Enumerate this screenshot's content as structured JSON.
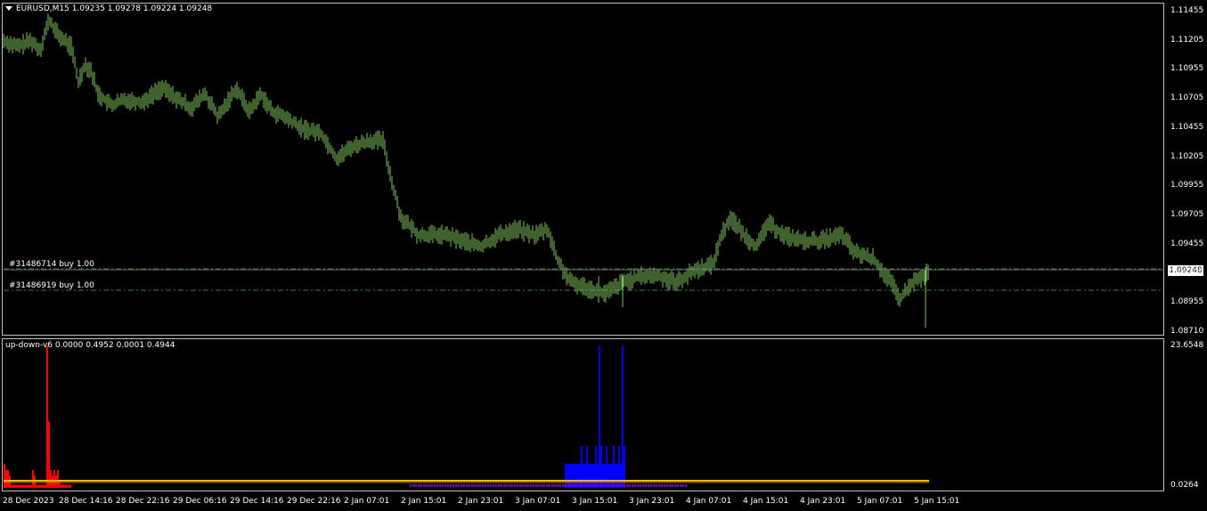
{
  "main_chart": {
    "title": "EURUSD,M15  1.09235 1.09278 1.09224 1.09248",
    "current_price_label": "1.09248",
    "price_ticks": [
      "1.11455",
      "1.11205",
      "1.10955",
      "1.10705",
      "1.10455",
      "1.10205",
      "1.09955",
      "1.09705",
      "1.09455",
      "1.09205",
      "1.08955",
      "1.08710"
    ],
    "orders": [
      {
        "label": "#31486714 buy 1.00",
        "price": 1.0926
      },
      {
        "label": "#31486919 buy 1.00",
        "price": 1.09165
      }
    ]
  },
  "indicator_panel": {
    "title": "up-down-v6 0.0000 0.4952 0.0001 0.4944",
    "top_tick": "23.6548",
    "bottom_tick": "0.0264"
  },
  "time_axis": [
    "28 Dec 2023",
    "28 Dec 14:16",
    "28 Dec 22:16",
    "29 Dec 06:16",
    "29 Dec 14:16",
    "29 Dec 22:16",
    "2 Jan 07:01",
    "2 Jan 15:01",
    "2 Jan 23:01",
    "3 Jan 07:01",
    "3 Jan 15:01",
    "3 Jan 23:01",
    "4 Jan 07:01",
    "4 Jan 15:01",
    "4 Jan 23:01",
    "5 Jan 07:01",
    "5 Jan 15:01"
  ],
  "colors": {
    "background": "#000000",
    "candles": "#7fc45a",
    "order_line": "#3a7d3a",
    "up_bars": "#ff0000",
    "down_bars": "#0000ff",
    "signal_line": "#ffb400",
    "grid_border": "#bfbfbf"
  },
  "chart_data": [
    {
      "type": "line",
      "title": "EURUSD,M15",
      "x": [
        "28 Dec 2023",
        "28 Dec 14:16",
        "28 Dec 22:16",
        "29 Dec 06:16",
        "29 Dec 14:16",
        "29 Dec 22:16",
        "2 Jan 07:01",
        "2 Jan 15:01",
        "2 Jan 23:01",
        "3 Jan 07:01",
        "3 Jan 15:01",
        "3 Jan 23:01",
        "4 Jan 07:01",
        "4 Jan 15:01",
        "4 Jan 23:01",
        "5 Jan 07:01",
        "5 Jan 15:01"
      ],
      "series": [
        {
          "values": [
            1.112,
            1.106,
            1.1075,
            1.1068,
            1.107,
            1.1045,
            1.104,
            1.0955,
            1.0945,
            1.096,
            1.0915,
            1.092,
            1.093,
            1.0965,
            1.0955,
            1.093,
            1.0925
          ]
        }
      ],
      "ylim": [
        1.0871,
        1.1155
      ]
    },
    {
      "type": "bar",
      "title": "up-down-v6",
      "series": [
        {
          "values": [
            4,
            3,
            2,
            23.6,
            11,
            4,
            3,
            2,
            1,
            0.5,
            0.3,
            0.3,
            0.3,
            0.2,
            0.2,
            0.2,
            0.3,
            0.3,
            0.3,
            0.3
          ]
        },
        {
          "values": [
            0.2,
            0.2,
            0.2,
            0.3,
            0.5,
            0.4,
            4,
            4,
            7,
            7,
            4,
            7,
            4,
            23.6,
            7,
            23.6,
            7,
            0.3,
            0.2,
            0.2
          ]
        }
      ],
      "ylim": [
        0.0264,
        23.6548
      ]
    }
  ]
}
